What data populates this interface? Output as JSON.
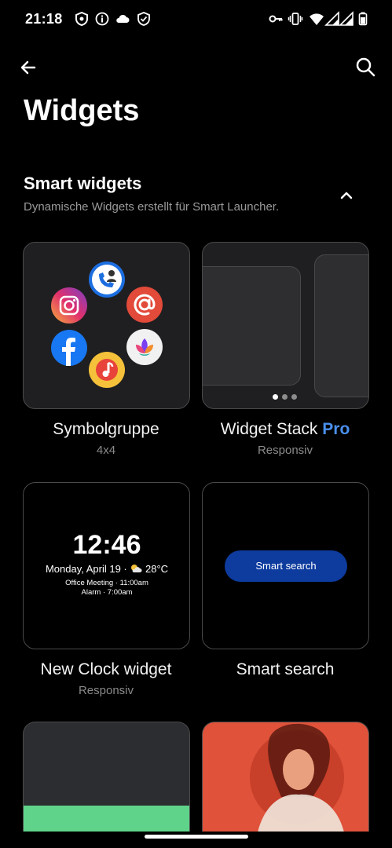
{
  "status_bar": {
    "time": "21:18",
    "left_icons": [
      "shield-badge-icon",
      "info-icon",
      "cloud-icon",
      "shield-check-icon"
    ],
    "right_icons": [
      "vpn-key-icon",
      "vibrate-icon",
      "wifi-icon",
      "signal-icon",
      "signal-icon",
      "battery-icon"
    ]
  },
  "header": {
    "title": "Widgets"
  },
  "section": {
    "title": "Smart widgets",
    "subtitle": "Dynamische Widgets erstellt für Smart Launcher.",
    "expanded": true
  },
  "widgets": [
    {
      "name": "Symbolgruppe",
      "sub": "4x4"
    },
    {
      "name": "Widget Stack",
      "badge": "Pro",
      "sub": "Responsiv"
    },
    {
      "name": "New Clock widget",
      "sub": "Responsiv"
    },
    {
      "name": "Smart search",
      "sub": ""
    }
  ],
  "clock_preview": {
    "time": "12:46",
    "date": "Monday, April 19 · ",
    "temp": "28°C",
    "event1": "Office Meeting · 11:00am",
    "event2": "Alarm · 7:00am"
  },
  "search_preview": {
    "label": "Smart search"
  },
  "icon_group": [
    "phone-contacts-icon",
    "instagram-icon",
    "email-at-icon",
    "facebook-icon",
    "lotus-icon",
    "music-icon"
  ],
  "stack_preview": {
    "active_page": 1,
    "pages": 3
  },
  "colors": {
    "background": "#000000",
    "accent_pro": "#4a90f0",
    "search_pill": "#0d3b9e",
    "bottom_card_accent": "#5fd38a",
    "bottom_card_photo": "#e0523a"
  }
}
